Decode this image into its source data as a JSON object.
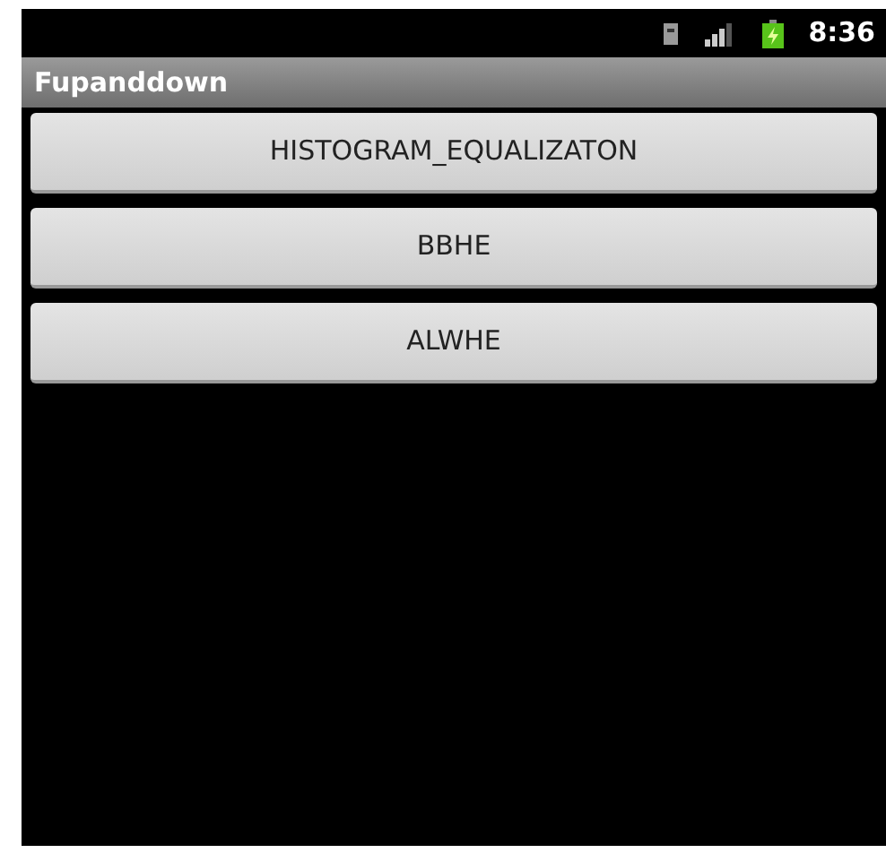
{
  "status_bar": {
    "time": "8:36"
  },
  "window": {
    "title": "Fupanddown"
  },
  "buttons": [
    {
      "label": "HISTOGRAM_EQUALIZATON"
    },
    {
      "label": "BBHE"
    },
    {
      "label": "ALWHE"
    }
  ]
}
